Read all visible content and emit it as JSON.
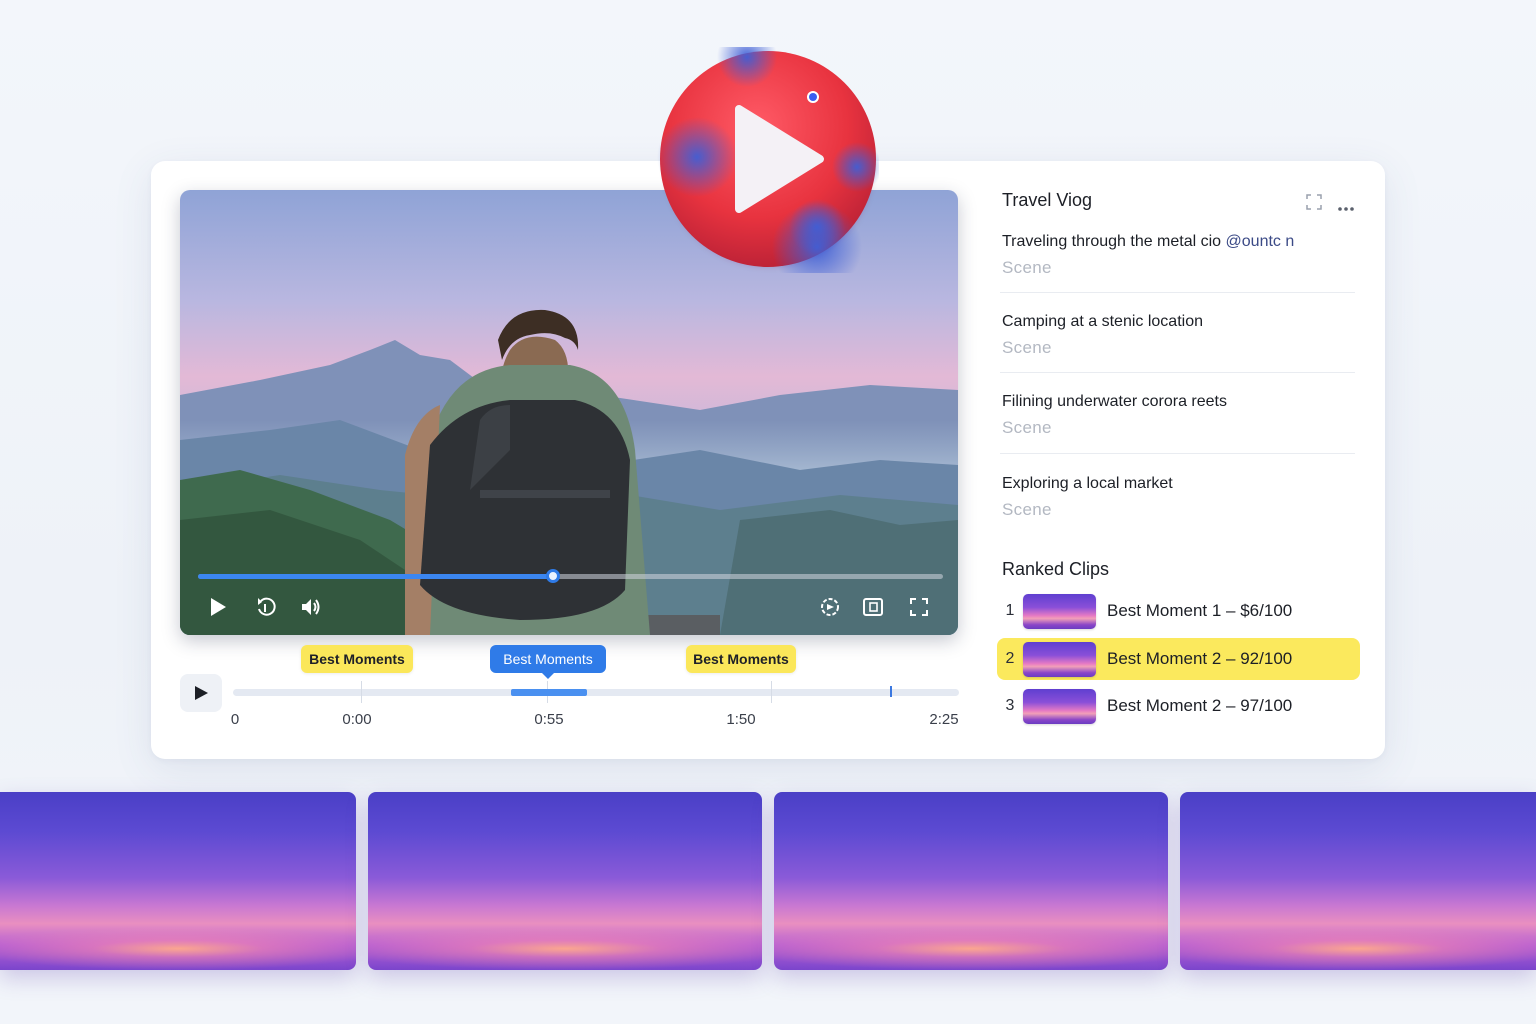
{
  "player": {
    "progress_fraction": 0.476,
    "controls": [
      "play-icon",
      "rewind-icon",
      "volume-icon",
      "speed-icon",
      "captions-icon",
      "fullscreen-icon"
    ]
  },
  "timeline": {
    "pills": [
      {
        "label": "Best Moments",
        "style": "yellow"
      },
      {
        "label": "Best Moments",
        "style": "blue"
      },
      {
        "label": "Best Moments",
        "style": "yellow"
      }
    ],
    "labels": [
      "0",
      "0:00",
      "0:55",
      "1:50",
      "2:25"
    ]
  },
  "panel": {
    "title": "Travel Viog",
    "scenes": [
      {
        "title": "Traveling through the metal cio",
        "handle": "@ountc n",
        "sub": "Scene"
      },
      {
        "title": "Camping at a stenic location",
        "handle": "",
        "sub": "Scene"
      },
      {
        "title": "Filining underwater corora reets",
        "handle": "",
        "sub": "Scene"
      },
      {
        "title": "Exploring a local market",
        "handle": "",
        "sub": "Scene"
      }
    ],
    "ranked_title": "Ranked Clips",
    "clips": [
      {
        "rank": "1",
        "label": "Best Moment 1 – $6/100",
        "active": false
      },
      {
        "rank": "2",
        "label": "Best Moment 2 – 92/100",
        "active": true
      },
      {
        "rank": "3",
        "label": "Best Moment 2 – 97/100",
        "active": false
      }
    ]
  },
  "colors": {
    "accent_blue": "#2f7be8",
    "highlight_yellow": "#fbe95d",
    "logo_red": "#e8333f"
  }
}
